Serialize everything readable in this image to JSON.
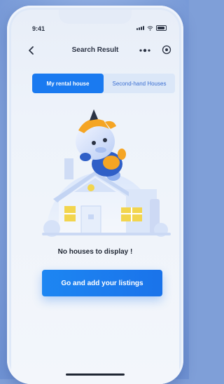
{
  "status": {
    "time": "9:41"
  },
  "nav": {
    "title": "Search Result",
    "back_icon": "chevron-left-icon",
    "more_icon": "more-dots-icon",
    "target_icon": "target-icon"
  },
  "tabs": [
    {
      "label": "My rental house",
      "active": true
    },
    {
      "label": "Second-hand Houses",
      "active": false
    }
  ],
  "empty_state": {
    "message": "No houses to display !",
    "cta_label": "Go and add your listings",
    "illustration": "cow-mascot-on-house-illustration"
  },
  "colors": {
    "accent": "#1a7af0",
    "background": "#eef3fa",
    "text": "#1f2633"
  }
}
